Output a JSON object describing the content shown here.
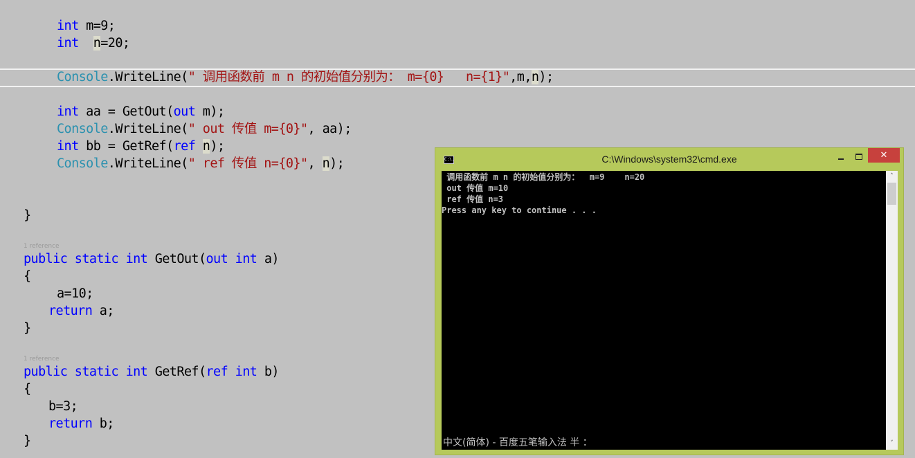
{
  "editor": {
    "current_line_highlight_color": "#f2f2f2",
    "colors": {
      "keyword": "#0000ff",
      "type": "#2b91af",
      "string": "#a31515",
      "plain": "#000000"
    },
    "lines": [
      {
        "id": "m-decl",
        "tokens": [
          {
            "t": "kw",
            "v": "int"
          },
          {
            "t": "pl",
            "v": " m=9;"
          }
        ]
      },
      {
        "id": "n-decl",
        "tokens": [
          {
            "t": "kw",
            "v": "int"
          },
          {
            "t": "pl",
            "v": "  "
          },
          {
            "t": "hl",
            "v": "n"
          },
          {
            "t": "pl",
            "v": "=20;"
          }
        ]
      },
      {
        "id": "writeline-initial",
        "tokens": [
          {
            "t": "ty",
            "v": "Console"
          },
          {
            "t": "pl",
            "v": ".WriteLine("
          },
          {
            "t": "str",
            "v": "\" 调用函数前 m n 的初始值分别为： m={0}   n={1}\""
          },
          {
            "t": "pl",
            "v": ",m,"
          },
          {
            "t": "hl",
            "v": "n"
          },
          {
            "t": "pl",
            "v": ");"
          }
        ]
      },
      {
        "id": "aa-decl",
        "tokens": [
          {
            "t": "kw",
            "v": "int"
          },
          {
            "t": "pl",
            "v": " aa = GetOut("
          },
          {
            "t": "kw",
            "v": "out"
          },
          {
            "t": "pl",
            "v": " m);"
          }
        ]
      },
      {
        "id": "writeline-out",
        "tokens": [
          {
            "t": "ty",
            "v": "Console"
          },
          {
            "t": "pl",
            "v": ".WriteLine("
          },
          {
            "t": "str",
            "v": "\" out 传值 m={0}\""
          },
          {
            "t": "pl",
            "v": ", aa);"
          }
        ]
      },
      {
        "id": "bb-decl",
        "tokens": [
          {
            "t": "kw",
            "v": "int"
          },
          {
            "t": "pl",
            "v": " bb = GetRef("
          },
          {
            "t": "kw",
            "v": "ref"
          },
          {
            "t": "pl",
            "v": " "
          },
          {
            "t": "hl",
            "v": "n"
          },
          {
            "t": "pl",
            "v": ");"
          }
        ]
      },
      {
        "id": "writeline-ref",
        "tokens": [
          {
            "t": "ty",
            "v": "Console"
          },
          {
            "t": "pl",
            "v": ".WriteLine("
          },
          {
            "t": "str",
            "v": "\" ref 传值 n={0}\""
          },
          {
            "t": "pl",
            "v": ", "
          },
          {
            "t": "hl",
            "v": "n"
          },
          {
            "t": "pl",
            "v": ");"
          }
        ]
      },
      {
        "id": "main-close",
        "tokens": [
          {
            "t": "pl",
            "v": "}"
          }
        ]
      },
      {
        "id": "getout-sig",
        "tokens": [
          {
            "t": "kw",
            "v": "public"
          },
          {
            "t": "pl",
            "v": " "
          },
          {
            "t": "kw",
            "v": "static"
          },
          {
            "t": "pl",
            "v": " "
          },
          {
            "t": "kw",
            "v": "int"
          },
          {
            "t": "pl",
            "v": " GetOut("
          },
          {
            "t": "kw",
            "v": "out"
          },
          {
            "t": "pl",
            "v": " "
          },
          {
            "t": "kw",
            "v": "int"
          },
          {
            "t": "pl",
            "v": " a)"
          }
        ]
      },
      {
        "id": "getout-open",
        "tokens": [
          {
            "t": "pl",
            "v": "{"
          }
        ]
      },
      {
        "id": "getout-assign",
        "tokens": [
          {
            "t": "pl",
            "v": "a=10;"
          }
        ]
      },
      {
        "id": "getout-return",
        "tokens": [
          {
            "t": "kw",
            "v": "return"
          },
          {
            "t": "pl",
            "v": " a;"
          }
        ]
      },
      {
        "id": "getout-close",
        "tokens": [
          {
            "t": "pl",
            "v": "}"
          }
        ]
      },
      {
        "id": "getref-sig",
        "tokens": [
          {
            "t": "kw",
            "v": "public"
          },
          {
            "t": "pl",
            "v": " "
          },
          {
            "t": "kw",
            "v": "static"
          },
          {
            "t": "pl",
            "v": " "
          },
          {
            "t": "kw",
            "v": "int"
          },
          {
            "t": "pl",
            "v": " GetRef("
          },
          {
            "t": "kw",
            "v": "ref"
          },
          {
            "t": "pl",
            "v": " "
          },
          {
            "t": "kw",
            "v": "int"
          },
          {
            "t": "pl",
            "v": " b)"
          }
        ]
      },
      {
        "id": "getref-open",
        "tokens": [
          {
            "t": "pl",
            "v": "{"
          }
        ]
      },
      {
        "id": "getref-assign",
        "tokens": [
          {
            "t": "pl",
            "v": "b=3;"
          }
        ]
      },
      {
        "id": "getref-return",
        "tokens": [
          {
            "t": "kw",
            "v": "return"
          },
          {
            "t": "pl",
            "v": " b;"
          }
        ]
      },
      {
        "id": "getref-close",
        "tokens": [
          {
            "t": "pl",
            "v": "}"
          }
        ]
      }
    ],
    "codelens": [
      {
        "id": "getout-refs",
        "label": "1 reference"
      },
      {
        "id": "getref-refs",
        "label": "1 reference"
      }
    ]
  },
  "console_window": {
    "title": "C:\\Windows\\system32\\cmd.exe",
    "icon_label": "C:\\.",
    "frame_color": "#b6c95b",
    "close_color": "#c7413d",
    "buttons": {
      "minimize": "minimize",
      "maximize": "maximize",
      "close": "✕"
    },
    "output_lines": [
      " 调用函数前 m n 的初始值分别为：  m=9    n=20",
      " out 传值 m=10",
      " ref 传值 n=3",
      "Press any key to continue . . ."
    ],
    "ime_status": "中文(简体) - 百度五笔输入法 半 ：",
    "scrollbar": {
      "up": "˄",
      "down": "˅"
    }
  }
}
